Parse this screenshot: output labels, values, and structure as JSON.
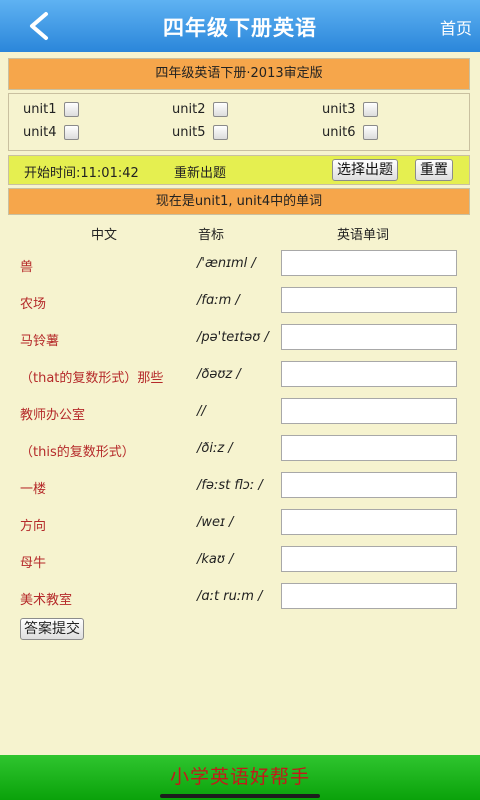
{
  "header": {
    "title": "四年级下册英语",
    "home_label": "首页"
  },
  "version_label": "四年级英语下册·2013审定版",
  "units": [
    "unit1",
    "unit2",
    "unit3",
    "unit4",
    "unit5",
    "unit6"
  ],
  "status": {
    "time_label": "开始时间:11:01:42",
    "refresh_label": "重新出题",
    "select_button": "选择出题",
    "reset_button": "重置"
  },
  "current_label": "现在是unit1, unit4中的单词",
  "columns": {
    "chinese": "中文",
    "phonetic": "音标",
    "english": "英语单词"
  },
  "questions": [
    {
      "cn": "兽",
      "ph": "/'ænɪml /"
    },
    {
      "cn": "农场",
      "ph": "/fɑːm /"
    },
    {
      "cn": "马铃薯",
      "ph": "/pə'teɪtəʊ /"
    },
    {
      "cn": "（that的复数形式）那些",
      "ph": "/ðəʊz /"
    },
    {
      "cn": "教师办公室",
      "ph": "//"
    },
    {
      "cn": "（this的复数形式）",
      "ph": "/ðiːz /"
    },
    {
      "cn": "一楼",
      "ph": "/fəːst flɔː /"
    },
    {
      "cn": "方向",
      "ph": "/weɪ /"
    },
    {
      "cn": "母牛",
      "ph": "/kaʊ /"
    },
    {
      "cn": "美术教室",
      "ph": "/ɑːt ruːm /"
    }
  ],
  "submit_label": "答案提交",
  "footer_text": "小学英语好帮手",
  "colors": {
    "header": "#3b97e4",
    "orange": "#f6a64b",
    "status_bar": "#e5ef50",
    "footer": "#1cb31c",
    "label_red": "#b52a2a"
  }
}
